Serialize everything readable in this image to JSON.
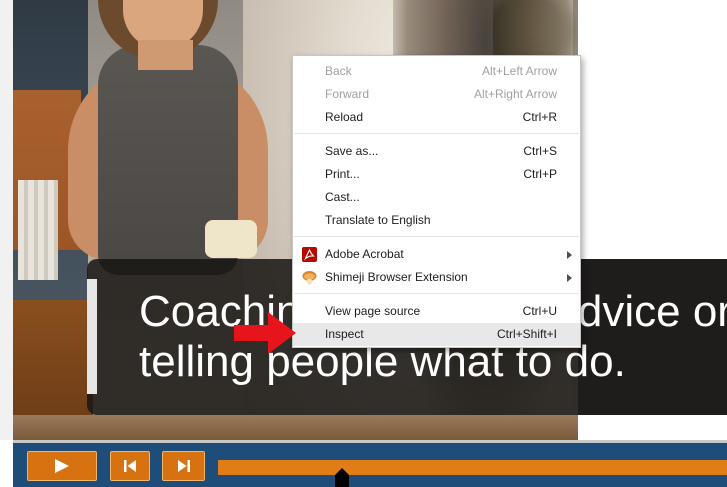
{
  "caption": {
    "line1": "Coaching isn't giving advice or",
    "line2": "telling people what to do."
  },
  "context_menu": {
    "items": [
      {
        "label": "Back",
        "shortcut": "Alt+Left Arrow",
        "disabled": true
      },
      {
        "label": "Forward",
        "shortcut": "Alt+Right Arrow",
        "disabled": true
      },
      {
        "label": "Reload",
        "shortcut": "Ctrl+R",
        "disabled": false
      },
      {
        "label": "Save as...",
        "shortcut": "Ctrl+S",
        "disabled": false
      },
      {
        "label": "Print...",
        "shortcut": "Ctrl+P",
        "disabled": false
      },
      {
        "label": "Cast...",
        "shortcut": "",
        "disabled": false
      },
      {
        "label": "Translate to English",
        "shortcut": "",
        "disabled": false
      },
      {
        "label": "Adobe Acrobat",
        "shortcut": "",
        "disabled": false,
        "icon": "adobe-acrobat-icon",
        "submenu": true
      },
      {
        "label": "Shimeji Browser Extension",
        "shortcut": "",
        "disabled": false,
        "icon": "shimeji-icon",
        "submenu": true
      },
      {
        "label": "View page source",
        "shortcut": "Ctrl+U",
        "disabled": false
      },
      {
        "label": "Inspect",
        "shortcut": "Ctrl+Shift+I",
        "disabled": false,
        "highlighted": true
      }
    ]
  },
  "player": {
    "play_icon": "play-icon",
    "prev_icon": "skip-previous-icon",
    "next_icon": "skip-next-icon",
    "progress_fraction": 0.24,
    "accent_color": "#d77211",
    "bar_color": "#1e4d7a"
  },
  "colors": {
    "pointer_arrow": "#e8141c",
    "highlight_row": "#e8e8e8"
  }
}
